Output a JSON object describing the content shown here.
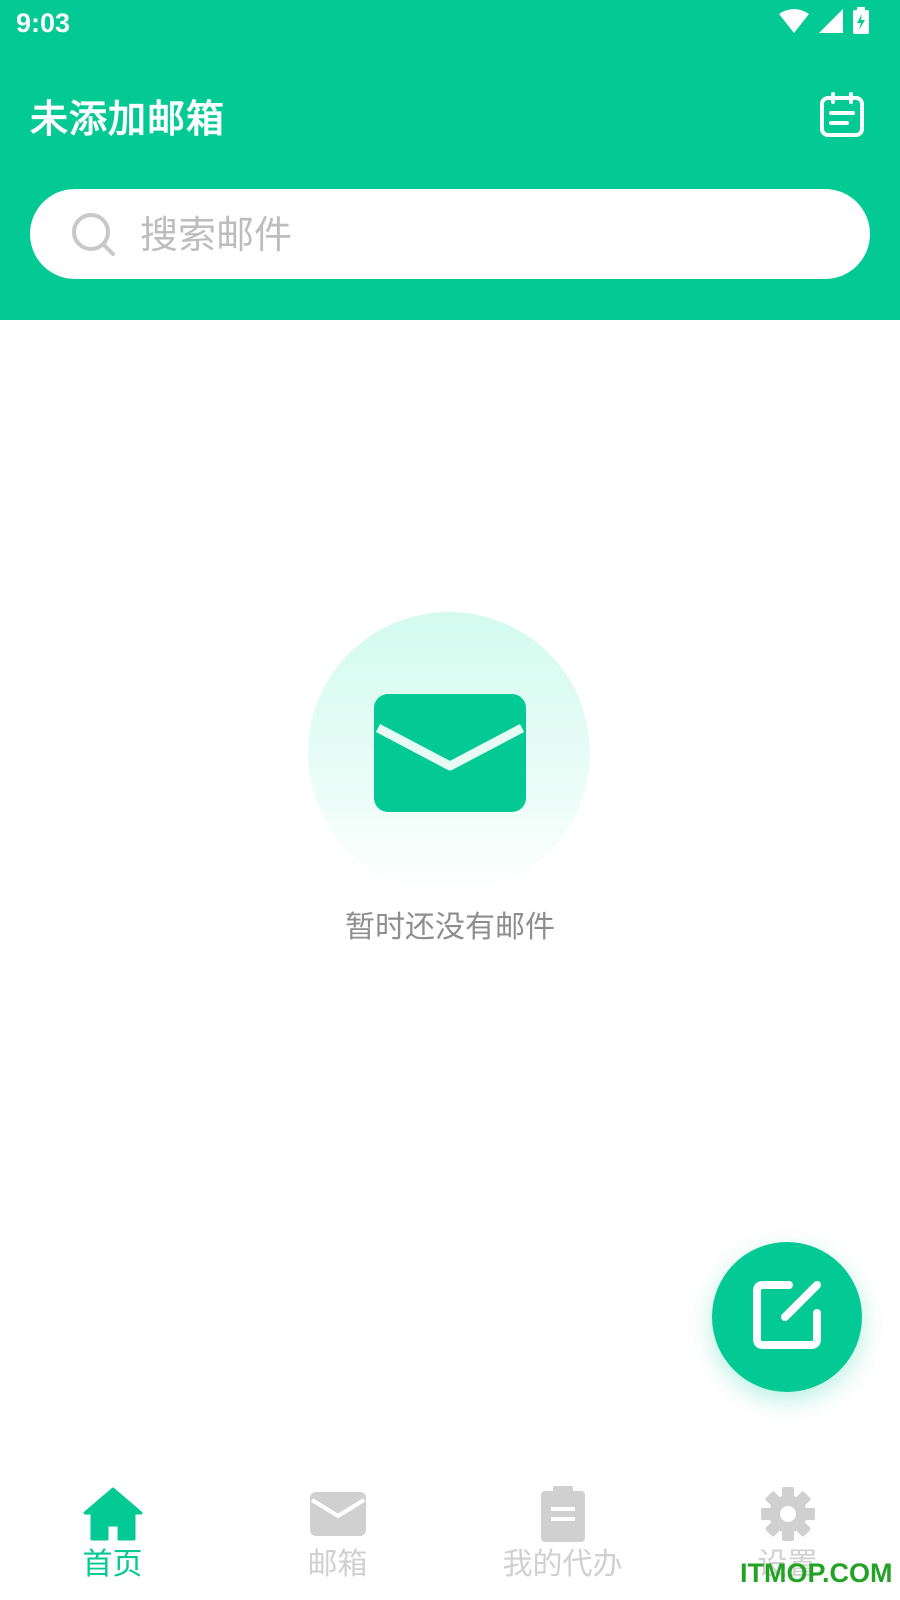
{
  "status_bar": {
    "time": "9:03",
    "icons": [
      "wifi-icon",
      "signal-icon",
      "battery-charging-icon"
    ]
  },
  "header": {
    "title": "未添加邮箱",
    "action_icon": "calendar-icon"
  },
  "search": {
    "placeholder": "搜索邮件",
    "icon": "search-icon"
  },
  "empty_state": {
    "icon": "envelope-icon",
    "message": "暂时还没有邮件"
  },
  "fab": {
    "icon": "compose-icon"
  },
  "bottom_nav": {
    "items": [
      {
        "label": "首页",
        "icon": "home-icon",
        "active": true
      },
      {
        "label": "邮箱",
        "icon": "mail-icon",
        "active": false
      },
      {
        "label": "我的代办",
        "icon": "clipboard-icon",
        "active": false
      },
      {
        "label": "设置",
        "icon": "gear-icon",
        "active": false
      }
    ]
  },
  "watermark": "ITMOP.COM",
  "colors": {
    "brand": "#03C994",
    "inactive": "#D0D0D0",
    "muted_text": "#8E8E8E"
  }
}
